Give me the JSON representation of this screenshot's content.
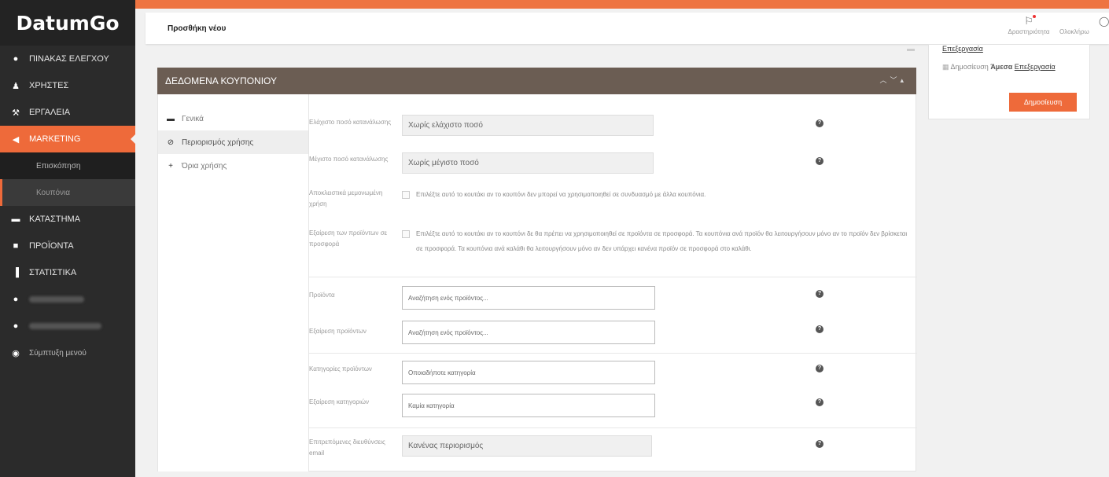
{
  "brand": "DatumGo",
  "sidebar": {
    "items": [
      {
        "icon": "dashboard-icon",
        "glyph": "●",
        "label": "ΠΙΝΑΚΑΣ ΕΛΕΓΧΟΥ"
      },
      {
        "icon": "user-icon",
        "glyph": "♟",
        "label": "ΧΡΗΣΤΕΣ"
      },
      {
        "icon": "wrench-icon",
        "glyph": "⚒",
        "label": "ΕΡΓΑΛΕΙΑ"
      },
      {
        "icon": "megaphone-icon",
        "glyph": "◀",
        "label": "MARKETING"
      }
    ],
    "marketing_sub": [
      "Επισκόπηση",
      "Κουπόνια"
    ],
    "items2": [
      {
        "icon": "store-icon",
        "glyph": "▬",
        "label": "ΚΑΤΑΣΤΗΜΑ"
      },
      {
        "icon": "box-icon",
        "glyph": "■",
        "label": "ΠΡΟΪΟΝΤΑ"
      },
      {
        "icon": "bar-chart-icon",
        "glyph": "▐",
        "label": "ΣΤΑΤΙΣΤΙΚΑ"
      }
    ],
    "collapse": "Σύμπτυξη μενού"
  },
  "topbar": {
    "title": "Προσθήκη νέου",
    "activity": "Δραστηριότητα",
    "complete": "Ολοκλήρω"
  },
  "publish": {
    "edit_link": "Επεξεργασία",
    "publish_prefix": "Δημοσίευση",
    "publish_when": "Άμεσα",
    "button": "Δημοσίευση"
  },
  "coupon": {
    "header": "ΔΕΔΟΜΕΝΑ ΚΟΥΠΟΝΙΟΥ",
    "tabs": [
      {
        "icon": "ticket-icon",
        "glyph": "▬",
        "label": "Γενικά"
      },
      {
        "icon": "ban-icon",
        "glyph": "⊘",
        "label": "Περιορισμός χρήσης"
      },
      {
        "icon": "plus-icon",
        "glyph": "+",
        "label": "Όρια χρήσης"
      }
    ],
    "fields": {
      "min_label": "Ελάχιστο ποσό κατανάλωσης",
      "min_value": "Χωρίς ελάχιστο ποσό",
      "max_label": "Μέγιστο ποσό κατανάλωσης",
      "max_value": "Χωρίς μέγιστο ποσό",
      "individual_label": "Αποκλειστικά μεμονωμένη χρήση",
      "individual_desc": "Επιλέξτε αυτό το κουτάκι αν το κουπόνι δεν μπορεί να χρησιμοποιηθεί σε συνδυασμό με άλλα κουπόνια.",
      "exclude_sale_label": "Εξαίρεση των προϊόντων σε προσφορά",
      "exclude_sale_desc": "Επιλέξτε αυτό το κουτάκι αν το κουπόνι δε θα πρέπει να χρησιμοποιηθεί σε προϊόντα σε προσφορά. Τα κουπόνια ανά προϊόν θα λειτουργήσουν μόνο αν το προϊόν δεν βρίσκεται σε προσφορά. Τα κουπόνια ανά καλάθι θα λειτουργήσουν μόνο αν δεν υπάρχει κανένα προϊόν σε προσφορά στο καλάθι.",
      "products_label": "Προϊόντα",
      "products_placeholder": "Αναζήτηση ενός προϊόντος...",
      "exclude_products_label": "Εξαίρεση προϊόντων",
      "exclude_products_placeholder": "Αναζήτηση ενός προϊόντος...",
      "categories_label": "Κατηγορίες προϊόντων",
      "categories_placeholder": "Οποιαδήποτε κατηγορία",
      "exclude_categories_label": "Εξαίρεση κατηγοριών",
      "exclude_categories_placeholder": "Καμία κατηγορία",
      "emails_label": "Επιτρεπόμενες διευθύνσεις email",
      "emails_value": "Κανένας περιορισμός"
    }
  },
  "colors": {
    "accent": "#ee6a3a",
    "sidebar": "#2b2b2b",
    "header": "#6b5d53"
  }
}
